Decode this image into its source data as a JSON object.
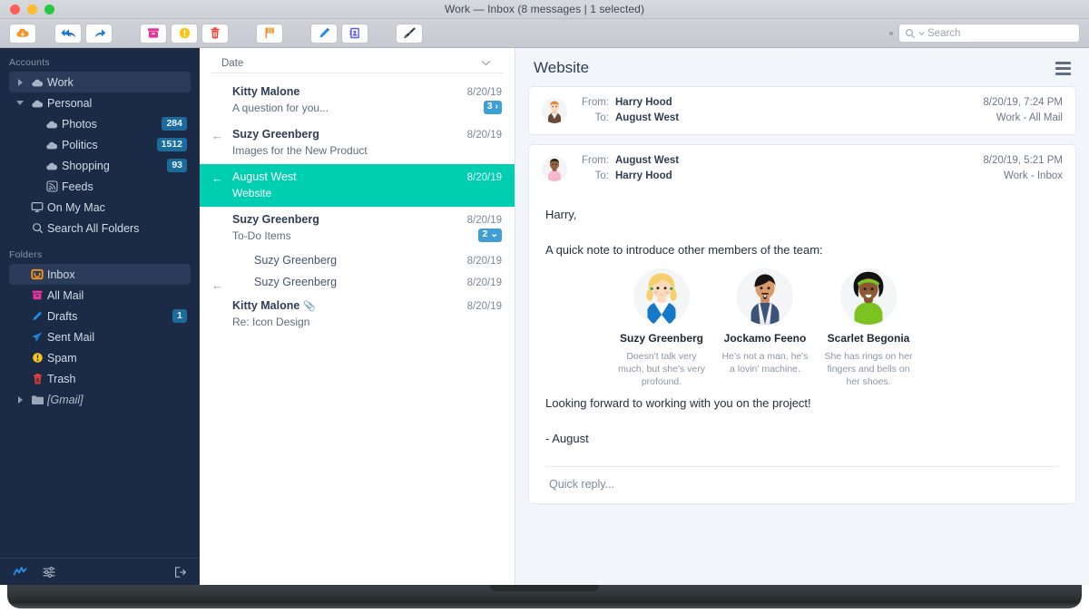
{
  "window": {
    "title": "Work — Inbox (8 messages | 1 selected)"
  },
  "toolbar": {
    "buttons": [
      {
        "name": "get-mail-button",
        "icon": "cloud-download-icon"
      },
      {
        "name": "reply-all-button",
        "icon": "reply-all-icon"
      },
      {
        "name": "forward-button",
        "icon": "forward-arrow-icon"
      },
      {
        "name": "archive-button",
        "icon": "archive-box-icon"
      },
      {
        "name": "spam-button",
        "icon": "warning-circle-icon"
      },
      {
        "name": "delete-button",
        "icon": "trash-icon"
      },
      {
        "name": "flag-button",
        "icon": "flag-icon"
      },
      {
        "name": "compose-button",
        "icon": "pencil-icon"
      },
      {
        "name": "contacts-button",
        "icon": "address-book-icon"
      },
      {
        "name": "cleanup-button",
        "icon": "brush-icon"
      }
    ],
    "search": {
      "placeholder": "Search",
      "value": ""
    }
  },
  "sidebar": {
    "accounts_label": "Accounts",
    "folders_label": "Folders",
    "accounts": [
      {
        "label": "Work",
        "icon": "cloud-icon",
        "indent": 0,
        "twisty": "right",
        "selected": true,
        "badge": ""
      },
      {
        "label": "Personal",
        "icon": "cloud-icon",
        "indent": 0,
        "twisty": "down",
        "selected": false,
        "badge": ""
      },
      {
        "label": "Photos",
        "icon": "cloud-icon",
        "indent": 1,
        "twisty": "",
        "selected": false,
        "badge": "284"
      },
      {
        "label": "Politics",
        "icon": "cloud-icon",
        "indent": 1,
        "twisty": "",
        "selected": false,
        "badge": "1512"
      },
      {
        "label": "Shopping",
        "icon": "cloud-icon",
        "indent": 1,
        "twisty": "",
        "selected": false,
        "badge": "93"
      },
      {
        "label": "Feeds",
        "icon": "rss-icon",
        "indent": 1,
        "twisty": "",
        "selected": false,
        "badge": ""
      },
      {
        "label": "On My Mac",
        "icon": "display-icon",
        "indent": 0,
        "twisty": "",
        "selected": false,
        "badge": ""
      },
      {
        "label": "Search All Folders",
        "icon": "search-icon",
        "indent": 0,
        "twisty": "",
        "selected": false,
        "badge": ""
      }
    ],
    "folders": [
      {
        "label": "Inbox",
        "icon": "inbox-icon",
        "indent": 0,
        "twisty": "",
        "selected": true,
        "badge": "",
        "italic": false
      },
      {
        "label": "All Mail",
        "icon": "archive-box-icon",
        "indent": 0,
        "twisty": "",
        "selected": false,
        "badge": "",
        "italic": false
      },
      {
        "label": "Drafts",
        "icon": "pencil-icon",
        "indent": 0,
        "twisty": "",
        "selected": false,
        "badge": "1",
        "italic": false
      },
      {
        "label": "Sent Mail",
        "icon": "paper-plane-icon",
        "indent": 0,
        "twisty": "",
        "selected": false,
        "badge": "",
        "italic": false
      },
      {
        "label": "Spam",
        "icon": "warning-circle-icon",
        "indent": 0,
        "twisty": "",
        "selected": false,
        "badge": "",
        "italic": false
      },
      {
        "label": "Trash",
        "icon": "trash-icon",
        "indent": 0,
        "twisty": "",
        "selected": false,
        "badge": "",
        "italic": false
      },
      {
        "label": "[Gmail]",
        "icon": "folder-icon",
        "indent": 0,
        "twisty": "right",
        "selected": false,
        "badge": "",
        "italic": true
      }
    ],
    "footer": [
      {
        "name": "activity-icon"
      },
      {
        "name": "filter-sliders-icon"
      },
      {
        "name": "logout-icon"
      }
    ]
  },
  "message_list": {
    "sort_label": "Date",
    "sort_chevron": "chevron-down-icon",
    "messages": [
      {
        "from": "Kitty Malone",
        "subject": "A question for you...",
        "date": "8/20/19",
        "count": "3",
        "count_chevron": "›",
        "replied": false,
        "selected": false,
        "sub": false,
        "attachment": false,
        "unread": true
      },
      {
        "from": "Suzy Greenberg",
        "subject": "Images for the New Product",
        "date": "8/20/19",
        "count": "",
        "count_chevron": "",
        "replied": true,
        "selected": false,
        "sub": false,
        "attachment": false,
        "unread": true
      },
      {
        "from": "August West",
        "subject": "Website",
        "date": "8/20/19",
        "count": "",
        "count_chevron": "",
        "replied": true,
        "selected": true,
        "sub": false,
        "attachment": false,
        "unread": false
      },
      {
        "from": "Suzy Greenberg",
        "subject": "To-Do Items",
        "date": "8/20/19",
        "count": "2",
        "count_chevron": "⌄",
        "replied": false,
        "selected": false,
        "sub": false,
        "attachment": false,
        "unread": true
      },
      {
        "from": "Suzy Greenberg",
        "subject": "",
        "date": "8/20/19",
        "count": "",
        "count_chevron": "",
        "replied": false,
        "selected": false,
        "sub": true,
        "attachment": false,
        "unread": false
      },
      {
        "from": "Suzy Greenberg",
        "subject": "",
        "date": "8/20/19",
        "count": "",
        "count_chevron": "",
        "replied": true,
        "selected": false,
        "sub": true,
        "attachment": false,
        "unread": false
      },
      {
        "from": "Kitty Malone",
        "subject": "Re: Icon Design",
        "date": "8/20/19",
        "count": "",
        "count_chevron": "",
        "replied": false,
        "selected": false,
        "sub": false,
        "attachment": true,
        "unread": true
      }
    ]
  },
  "reader": {
    "title": "Website",
    "menu_icon": "hamburger-icon",
    "headers": [
      {
        "from_label": "From:",
        "from_value": "Harry Hood",
        "to_label": "To:",
        "to_value": "August West",
        "timestamp": "8/20/19, 7:24 PM",
        "mailbox": "Work - All Mail",
        "avatar": "harry-hood-avatar"
      },
      {
        "from_label": "From:",
        "from_value": "August West",
        "to_label": "To:",
        "to_value": "Harry Hood",
        "timestamp": "8/20/19, 5:21 PM",
        "mailbox": "Work - Inbox",
        "avatar": "august-west-avatar"
      }
    ],
    "body": {
      "greeting": "Harry,",
      "intro": "A quick note to introduce other members of the team:",
      "closing": "Looking forward to working with you on the project!",
      "signature": "- August",
      "team": [
        {
          "name": "Suzy Greenberg",
          "desc": "Doesn't talk very much, but she's very profound.",
          "avatar": "suzy-greenberg-avatar"
        },
        {
          "name": "Jockamo Feeno",
          "desc": "He's not a man, he's a lovin' machine.",
          "avatar": "jockamo-feeno-avatar"
        },
        {
          "name": "Scarlet Begonia",
          "desc": "She has rings on her fingers and bells on her shoes.",
          "avatar": "scarlet-begonia-avatar"
        }
      ]
    },
    "quick_reply_placeholder": "Quick reply..."
  },
  "colors": {
    "sidebar_bg": "#1b2b45",
    "selection_teal": "#00ceb0",
    "badge_blue": "#1b6b9c",
    "count_blue": "#3f9fd4",
    "accent_orange": "#f5a623"
  }
}
